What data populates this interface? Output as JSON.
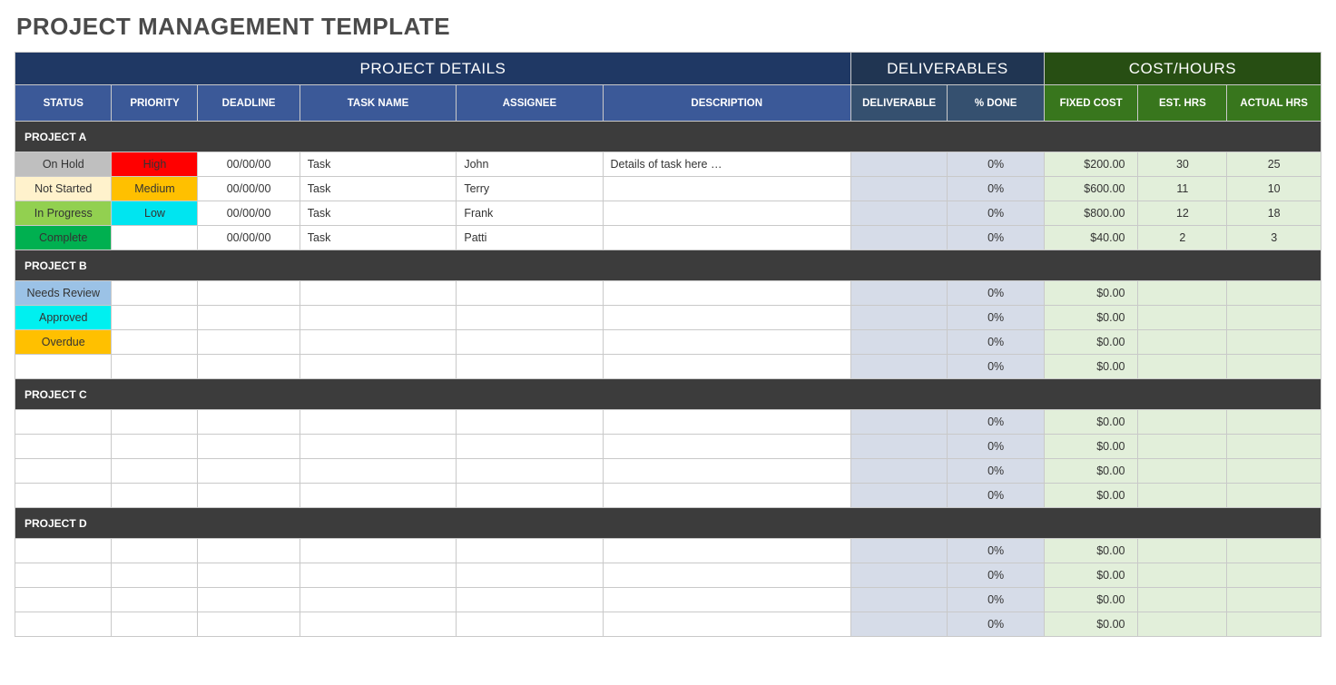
{
  "title": "PROJECT MANAGEMENT TEMPLATE",
  "sections": {
    "project_details": "PROJECT DETAILS",
    "deliverables": "DELIVERABLES",
    "cost_hours": "COST/HOURS"
  },
  "columns": {
    "status": "STATUS",
    "priority": "PRIORITY",
    "deadline": "DEADLINE",
    "task_name": "TASK NAME",
    "assignee": "ASSIGNEE",
    "description": "DESCRIPTION",
    "deliverable": "DELIVERABLE",
    "pct_done": "% DONE",
    "fixed_cost": "FIXED COST",
    "est_hrs": "EST. HRS",
    "actual_hrs": "ACTUAL HRS"
  },
  "groups": [
    {
      "name": "PROJECT A",
      "rows": [
        {
          "status": "On Hold",
          "status_cls": "st-onhold",
          "priority": "High",
          "priority_cls": "pr-high",
          "deadline": "00/00/00",
          "task": "Task",
          "assignee": "John",
          "desc": "Details of task here …",
          "deliv": "",
          "done": "0%",
          "fcost": "$200.00",
          "ehrs": "30",
          "ahrs": "25"
        },
        {
          "status": "Not Started",
          "status_cls": "st-notstarted",
          "priority": "Medium",
          "priority_cls": "pr-medium",
          "deadline": "00/00/00",
          "task": "Task",
          "assignee": "Terry",
          "desc": "",
          "deliv": "",
          "done": "0%",
          "fcost": "$600.00",
          "ehrs": "11",
          "ahrs": "10"
        },
        {
          "status": "In Progress",
          "status_cls": "st-inprogress",
          "priority": "Low",
          "priority_cls": "pr-low",
          "deadline": "00/00/00",
          "task": "Task",
          "assignee": "Frank",
          "desc": "",
          "deliv": "",
          "done": "0%",
          "fcost": "$800.00",
          "ehrs": "12",
          "ahrs": "18"
        },
        {
          "status": "Complete",
          "status_cls": "st-complete",
          "priority": "",
          "priority_cls": "pr-blank",
          "deadline": "00/00/00",
          "task": "Task",
          "assignee": "Patti",
          "desc": "",
          "deliv": "",
          "done": "0%",
          "fcost": "$40.00",
          "ehrs": "2",
          "ahrs": "3"
        }
      ]
    },
    {
      "name": "PROJECT B",
      "rows": [
        {
          "status": "Needs Review",
          "status_cls": "st-needsreview",
          "priority": "",
          "priority_cls": "pr-blank",
          "deadline": "",
          "task": "",
          "assignee": "",
          "desc": "",
          "deliv": "",
          "done": "0%",
          "fcost": "$0.00",
          "ehrs": "",
          "ahrs": ""
        },
        {
          "status": "Approved",
          "status_cls": "st-approved",
          "priority": "",
          "priority_cls": "pr-blank",
          "deadline": "",
          "task": "",
          "assignee": "",
          "desc": "",
          "deliv": "",
          "done": "0%",
          "fcost": "$0.00",
          "ehrs": "",
          "ahrs": ""
        },
        {
          "status": "Overdue",
          "status_cls": "st-overdue",
          "priority": "",
          "priority_cls": "pr-blank",
          "deadline": "",
          "task": "",
          "assignee": "",
          "desc": "",
          "deliv": "",
          "done": "0%",
          "fcost": "$0.00",
          "ehrs": "",
          "ahrs": ""
        },
        {
          "status": "",
          "status_cls": "st-blank",
          "priority": "",
          "priority_cls": "pr-blank",
          "deadline": "",
          "task": "",
          "assignee": "",
          "desc": "",
          "deliv": "",
          "done": "0%",
          "fcost": "$0.00",
          "ehrs": "",
          "ahrs": ""
        }
      ]
    },
    {
      "name": "PROJECT C",
      "rows": [
        {
          "status": "",
          "status_cls": "st-blank",
          "priority": "",
          "priority_cls": "pr-blank",
          "deadline": "",
          "task": "",
          "assignee": "",
          "desc": "",
          "deliv": "",
          "done": "0%",
          "fcost": "$0.00",
          "ehrs": "",
          "ahrs": ""
        },
        {
          "status": "",
          "status_cls": "st-blank",
          "priority": "",
          "priority_cls": "pr-blank",
          "deadline": "",
          "task": "",
          "assignee": "",
          "desc": "",
          "deliv": "",
          "done": "0%",
          "fcost": "$0.00",
          "ehrs": "",
          "ahrs": ""
        },
        {
          "status": "",
          "status_cls": "st-blank",
          "priority": "",
          "priority_cls": "pr-blank",
          "deadline": "",
          "task": "",
          "assignee": "",
          "desc": "",
          "deliv": "",
          "done": "0%",
          "fcost": "$0.00",
          "ehrs": "",
          "ahrs": ""
        },
        {
          "status": "",
          "status_cls": "st-blank",
          "priority": "",
          "priority_cls": "pr-blank",
          "deadline": "",
          "task": "",
          "assignee": "",
          "desc": "",
          "deliv": "",
          "done": "0%",
          "fcost": "$0.00",
          "ehrs": "",
          "ahrs": ""
        }
      ]
    },
    {
      "name": "PROJECT D",
      "rows": [
        {
          "status": "",
          "status_cls": "st-blank",
          "priority": "",
          "priority_cls": "pr-blank",
          "deadline": "",
          "task": "",
          "assignee": "",
          "desc": "",
          "deliv": "",
          "done": "0%",
          "fcost": "$0.00",
          "ehrs": "",
          "ahrs": ""
        },
        {
          "status": "",
          "status_cls": "st-blank",
          "priority": "",
          "priority_cls": "pr-blank",
          "deadline": "",
          "task": "",
          "assignee": "",
          "desc": "",
          "deliv": "",
          "done": "0%",
          "fcost": "$0.00",
          "ehrs": "",
          "ahrs": ""
        },
        {
          "status": "",
          "status_cls": "st-blank",
          "priority": "",
          "priority_cls": "pr-blank",
          "deadline": "",
          "task": "",
          "assignee": "",
          "desc": "",
          "deliv": "",
          "done": "0%",
          "fcost": "$0.00",
          "ehrs": "",
          "ahrs": ""
        },
        {
          "status": "",
          "status_cls": "st-blank",
          "priority": "",
          "priority_cls": "pr-blank",
          "deadline": "",
          "task": "",
          "assignee": "",
          "desc": "",
          "deliv": "",
          "done": "0%",
          "fcost": "$0.00",
          "ehrs": "",
          "ahrs": ""
        }
      ]
    }
  ]
}
